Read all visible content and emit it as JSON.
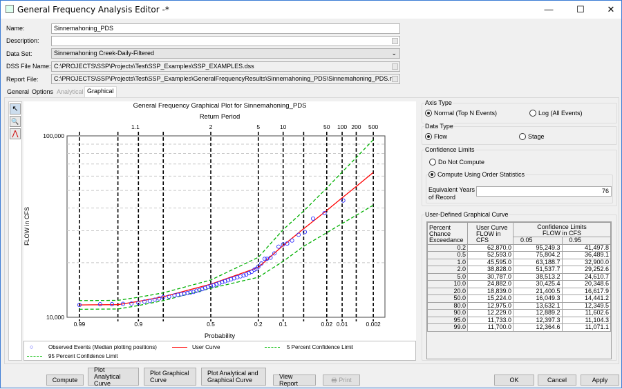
{
  "window": {
    "title": "General Frequency Analysis Editor -*",
    "minimize": "—",
    "maximize": "☐",
    "close": "✕"
  },
  "form": {
    "name_label": "Name:",
    "name_value": "Sinnemahoning_PDS",
    "description_label": "Description:",
    "description_value": "",
    "dataset_label": "Data Set:",
    "dataset_value": "Sinnemahoning Creek-Daily-Filtered",
    "dss_label": "DSS File Name:",
    "dss_value": "C:\\PROJECTS\\SSP\\Projects\\Test\\SSP_Examples\\SSP_EXAMPLES.dss",
    "report_label": "Report File:",
    "report_value": "C:\\PROJECTS\\SSP\\Projects\\Test\\SSP_Examples\\GeneralFrequencyResults\\Sinnemahoning_PDS\\Sinnemahoning_PDS.rpt"
  },
  "tabs": [
    {
      "label": "General"
    },
    {
      "label": "Options"
    },
    {
      "label": "Analytical",
      "disabled": true
    },
    {
      "label": "Graphical",
      "active": true
    }
  ],
  "tools": [
    {
      "icon": "pointer-icon",
      "glyph": "↖"
    },
    {
      "icon": "zoom-icon",
      "glyph": "🔍"
    },
    {
      "icon": "curve-edit-icon",
      "glyph": "⋀"
    }
  ],
  "chart_data": {
    "type": "scatter",
    "title": "General Frequency Graphical Plot for Sinnemahoning_PDS",
    "top_axis_label": "Return Period",
    "xlabel": "Probability",
    "ylabel": "FLOW in CFS",
    "x_scale": "normal-probability",
    "y_scale": "log",
    "ylim": [
      10000,
      100000
    ],
    "y_ticks": [
      "100,000",
      "10,000"
    ],
    "x_ticks": [
      0.99,
      0.9,
      0.5,
      0.2,
      0.1,
      0.02,
      0.01,
      0.002
    ],
    "x_tick_labels": [
      "0.99",
      "0.9",
      "0.5",
      "0.2",
      "0.1",
      "0.02",
      "0.01",
      "0.002"
    ],
    "return_period_ticks": [
      "1.1",
      "2",
      "5",
      "10",
      "50",
      "100",
      "200",
      "500"
    ],
    "vertical_gridlines": [
      0.99,
      0.95,
      0.9,
      0.8,
      0.5,
      0.2,
      0.1,
      0.05,
      0.02,
      0.01,
      0.005,
      0.002
    ],
    "horizontal_gridlines": [
      20000,
      30000,
      40000,
      50000,
      60000,
      70000,
      80000,
      90000
    ],
    "series": [
      {
        "name": "Observed Events (Median plotting positions)",
        "style": "circle",
        "color": "#3333ff",
        "points": [
          [
            0.0095,
            44000
          ],
          [
            0.022,
            37500
          ],
          [
            0.035,
            35000
          ],
          [
            0.048,
            29500
          ],
          [
            0.06,
            28500
          ],
          [
            0.075,
            26500
          ],
          [
            0.088,
            25500
          ],
          [
            0.1,
            25200
          ],
          [
            0.115,
            24500
          ],
          [
            0.13,
            22500
          ],
          [
            0.145,
            21300
          ],
          [
            0.16,
            21000
          ],
          [
            0.17,
            21000
          ],
          [
            0.185,
            19800
          ],
          [
            0.2,
            19000
          ],
          [
            0.21,
            18500
          ],
          [
            0.22,
            18300
          ],
          [
            0.235,
            17800
          ],
          [
            0.25,
            17500
          ],
          [
            0.265,
            17200
          ],
          [
            0.28,
            17000
          ],
          [
            0.3,
            16800
          ],
          [
            0.32,
            16600
          ],
          [
            0.34,
            16400
          ],
          [
            0.36,
            16200
          ],
          [
            0.38,
            16000
          ],
          [
            0.4,
            15800
          ],
          [
            0.42,
            15600
          ],
          [
            0.44,
            15400
          ],
          [
            0.46,
            15200
          ],
          [
            0.48,
            15000
          ],
          [
            0.5,
            14900
          ],
          [
            0.52,
            14700
          ],
          [
            0.54,
            14500
          ],
          [
            0.56,
            14300
          ],
          [
            0.58,
            14100
          ],
          [
            0.6,
            14000
          ],
          [
            0.62,
            13800
          ],
          [
            0.64,
            13700
          ],
          [
            0.66,
            13600
          ],
          [
            0.68,
            13500
          ],
          [
            0.7,
            13400
          ],
          [
            0.72,
            13300
          ],
          [
            0.74,
            13200
          ],
          [
            0.77,
            13000
          ],
          [
            0.8,
            12900
          ],
          [
            0.82,
            12700
          ],
          [
            0.84,
            12500
          ],
          [
            0.86,
            12300
          ],
          [
            0.88,
            12200
          ],
          [
            0.9,
            12000
          ],
          [
            0.92,
            11900
          ],
          [
            0.94,
            11850
          ],
          [
            0.96,
            11800
          ],
          [
            0.975,
            11800
          ],
          [
            0.99,
            11700
          ]
        ]
      },
      {
        "name": "User Curve",
        "style": "solid",
        "color": "#ff0000",
        "x": [
          0.002,
          0.005,
          0.01,
          0.02,
          0.05,
          0.1,
          0.2,
          0.5,
          0.8,
          0.9,
          0.95,
          0.99
        ],
        "values": [
          62870,
          52593,
          45595,
          38828,
          30787,
          24882,
          18839,
          15224,
          12975,
          12229,
          11733,
          11700
        ]
      },
      {
        "name": "5 Percent Confidence Limit",
        "style": "dashed",
        "color": "#00b000",
        "x": [
          0.002,
          0.005,
          0.01,
          0.02,
          0.05,
          0.1,
          0.2,
          0.5,
          0.8,
          0.9,
          0.95,
          0.99
        ],
        "values": [
          95249.3,
          75804.2,
          63188.7,
          51537.7,
          38513.2,
          30425.4,
          21400.5,
          16049.3,
          13632.1,
          12889.2,
          12397.3,
          12364.6
        ]
      },
      {
        "name": "95 Percent Confidence Limit",
        "style": "dashed",
        "color": "#00b000",
        "x": [
          0.002,
          0.005,
          0.01,
          0.02,
          0.05,
          0.1,
          0.2,
          0.5,
          0.8,
          0.9,
          0.95,
          0.99
        ],
        "values": [
          41497.8,
          36489.1,
          32900.0,
          29252.6,
          24610.7,
          20348.6,
          16617.9,
          14441.2,
          12349.5,
          11602.6,
          11104.3,
          11071.1
        ]
      }
    ],
    "legend_placement": "bottom"
  },
  "right": {
    "axis_type": {
      "title": "Axis Type",
      "options": [
        "Normal (Top N Events)",
        "Log (All Events)"
      ],
      "selected": 0
    },
    "data_type": {
      "title": "Data Type",
      "options": [
        "Flow",
        "Stage"
      ],
      "selected": 0
    },
    "confidence": {
      "title": "Confidence Limits",
      "options": [
        "Do Not Compute",
        "Compute Using Order Statistics"
      ],
      "selected": 1,
      "eq_years_label_1": "Equivalent Years",
      "eq_years_label_2": "of Record",
      "eq_years_value": "76"
    },
    "curve": {
      "title": "User-Defined Graphical Curve",
      "headers": {
        "pce_1": "Percent Chance",
        "pce_2": "Exceedance",
        "uc_1": "User Curve",
        "uc_2": "FLOW in",
        "uc_3": "CFS",
        "cl_1": "Confidence Limits",
        "cl_2": "FLOW in CFS",
        "c05": "0.05",
        "c95": "0.95"
      },
      "rows": [
        [
          "0.2",
          "62,870.0",
          "95,249.3",
          "41,497.8"
        ],
        [
          "0.5",
          "52,593.0",
          "75,804.2",
          "36,489.1"
        ],
        [
          "1.0",
          "45,595.0",
          "63,188.7",
          "32,900.0"
        ],
        [
          "2.0",
          "38,828.0",
          "51,537.7",
          "29,252.6"
        ],
        [
          "5.0",
          "30,787.0",
          "38,513.2",
          "24,610.7"
        ],
        [
          "10.0",
          "24,882.0",
          "30,425.4",
          "20,348.6"
        ],
        [
          "20.0",
          "18,839.0",
          "21,400.5",
          "16,617.9"
        ],
        [
          "50.0",
          "15,224.0",
          "16,049.3",
          "14,441.2"
        ],
        [
          "80.0",
          "12,975.0",
          "13,632.1",
          "12,349.5"
        ],
        [
          "90.0",
          "12,229.0",
          "12,889.2",
          "11,602.6"
        ],
        [
          "95.0",
          "11,733.0",
          "12,397.3",
          "11,104.3"
        ],
        [
          "99.0",
          "11,700.0",
          "12,364.6",
          "11,071.1"
        ]
      ]
    }
  },
  "buttons": {
    "compute": "Compute",
    "plot_analytical": "Plot Analytical Curve",
    "plot_graphical": "Plot Graphical Curve",
    "plot_both": "Plot Analytical and Graphical Curve",
    "view_report": "View Report",
    "print": "Print",
    "ok": "OK",
    "cancel": "Cancel",
    "apply": "Apply"
  }
}
